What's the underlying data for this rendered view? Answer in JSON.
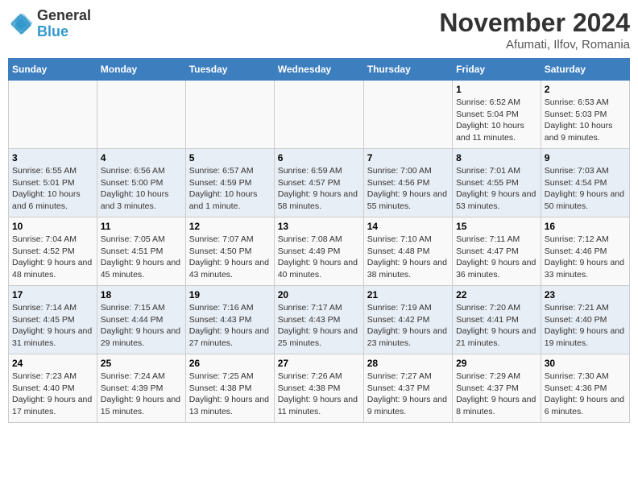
{
  "header": {
    "logo_general": "General",
    "logo_blue": "Blue",
    "month_year": "November 2024",
    "location": "Afumati, Ilfov, Romania"
  },
  "weekdays": [
    "Sunday",
    "Monday",
    "Tuesday",
    "Wednesday",
    "Thursday",
    "Friday",
    "Saturday"
  ],
  "weeks": [
    [
      {
        "day": "",
        "info": ""
      },
      {
        "day": "",
        "info": ""
      },
      {
        "day": "",
        "info": ""
      },
      {
        "day": "",
        "info": ""
      },
      {
        "day": "",
        "info": ""
      },
      {
        "day": "1",
        "info": "Sunrise: 6:52 AM\nSunset: 5:04 PM\nDaylight: 10 hours and 11 minutes."
      },
      {
        "day": "2",
        "info": "Sunrise: 6:53 AM\nSunset: 5:03 PM\nDaylight: 10 hours and 9 minutes."
      }
    ],
    [
      {
        "day": "3",
        "info": "Sunrise: 6:55 AM\nSunset: 5:01 PM\nDaylight: 10 hours and 6 minutes."
      },
      {
        "day": "4",
        "info": "Sunrise: 6:56 AM\nSunset: 5:00 PM\nDaylight: 10 hours and 3 minutes."
      },
      {
        "day": "5",
        "info": "Sunrise: 6:57 AM\nSunset: 4:59 PM\nDaylight: 10 hours and 1 minute."
      },
      {
        "day": "6",
        "info": "Sunrise: 6:59 AM\nSunset: 4:57 PM\nDaylight: 9 hours and 58 minutes."
      },
      {
        "day": "7",
        "info": "Sunrise: 7:00 AM\nSunset: 4:56 PM\nDaylight: 9 hours and 55 minutes."
      },
      {
        "day": "8",
        "info": "Sunrise: 7:01 AM\nSunset: 4:55 PM\nDaylight: 9 hours and 53 minutes."
      },
      {
        "day": "9",
        "info": "Sunrise: 7:03 AM\nSunset: 4:54 PM\nDaylight: 9 hours and 50 minutes."
      }
    ],
    [
      {
        "day": "10",
        "info": "Sunrise: 7:04 AM\nSunset: 4:52 PM\nDaylight: 9 hours and 48 minutes."
      },
      {
        "day": "11",
        "info": "Sunrise: 7:05 AM\nSunset: 4:51 PM\nDaylight: 9 hours and 45 minutes."
      },
      {
        "day": "12",
        "info": "Sunrise: 7:07 AM\nSunset: 4:50 PM\nDaylight: 9 hours and 43 minutes."
      },
      {
        "day": "13",
        "info": "Sunrise: 7:08 AM\nSunset: 4:49 PM\nDaylight: 9 hours and 40 minutes."
      },
      {
        "day": "14",
        "info": "Sunrise: 7:10 AM\nSunset: 4:48 PM\nDaylight: 9 hours and 38 minutes."
      },
      {
        "day": "15",
        "info": "Sunrise: 7:11 AM\nSunset: 4:47 PM\nDaylight: 9 hours and 36 minutes."
      },
      {
        "day": "16",
        "info": "Sunrise: 7:12 AM\nSunset: 4:46 PM\nDaylight: 9 hours and 33 minutes."
      }
    ],
    [
      {
        "day": "17",
        "info": "Sunrise: 7:14 AM\nSunset: 4:45 PM\nDaylight: 9 hours and 31 minutes."
      },
      {
        "day": "18",
        "info": "Sunrise: 7:15 AM\nSunset: 4:44 PM\nDaylight: 9 hours and 29 minutes."
      },
      {
        "day": "19",
        "info": "Sunrise: 7:16 AM\nSunset: 4:43 PM\nDaylight: 9 hours and 27 minutes."
      },
      {
        "day": "20",
        "info": "Sunrise: 7:17 AM\nSunset: 4:43 PM\nDaylight: 9 hours and 25 minutes."
      },
      {
        "day": "21",
        "info": "Sunrise: 7:19 AM\nSunset: 4:42 PM\nDaylight: 9 hours and 23 minutes."
      },
      {
        "day": "22",
        "info": "Sunrise: 7:20 AM\nSunset: 4:41 PM\nDaylight: 9 hours and 21 minutes."
      },
      {
        "day": "23",
        "info": "Sunrise: 7:21 AM\nSunset: 4:40 PM\nDaylight: 9 hours and 19 minutes."
      }
    ],
    [
      {
        "day": "24",
        "info": "Sunrise: 7:23 AM\nSunset: 4:40 PM\nDaylight: 9 hours and 17 minutes."
      },
      {
        "day": "25",
        "info": "Sunrise: 7:24 AM\nSunset: 4:39 PM\nDaylight: 9 hours and 15 minutes."
      },
      {
        "day": "26",
        "info": "Sunrise: 7:25 AM\nSunset: 4:38 PM\nDaylight: 9 hours and 13 minutes."
      },
      {
        "day": "27",
        "info": "Sunrise: 7:26 AM\nSunset: 4:38 PM\nDaylight: 9 hours and 11 minutes."
      },
      {
        "day": "28",
        "info": "Sunrise: 7:27 AM\nSunset: 4:37 PM\nDaylight: 9 hours and 9 minutes."
      },
      {
        "day": "29",
        "info": "Sunrise: 7:29 AM\nSunset: 4:37 PM\nDaylight: 9 hours and 8 minutes."
      },
      {
        "day": "30",
        "info": "Sunrise: 7:30 AM\nSunset: 4:36 PM\nDaylight: 9 hours and 6 minutes."
      }
    ]
  ]
}
